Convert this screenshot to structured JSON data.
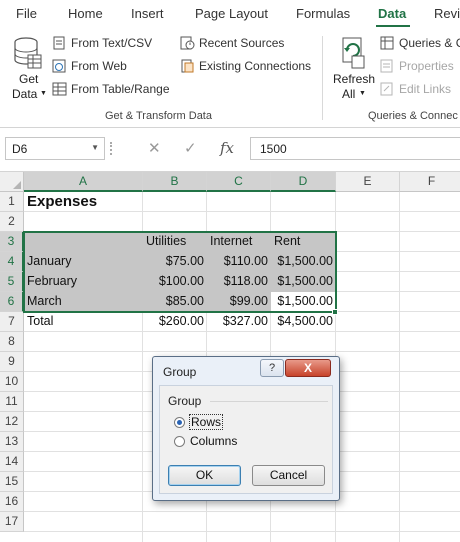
{
  "tabs": [
    {
      "label": "File"
    },
    {
      "label": "Home"
    },
    {
      "label": "Insert"
    },
    {
      "label": "Page Layout"
    },
    {
      "label": "Formulas"
    },
    {
      "label": "Data"
    },
    {
      "label": "Revie"
    }
  ],
  "active_tab": "Data",
  "ribbon": {
    "get_data_line1": "Get",
    "get_data_line2": "Data",
    "from_text_csv": "From Text/CSV",
    "from_web": "From Web",
    "from_table_range": "From Table/Range",
    "recent_sources": "Recent Sources",
    "existing_connections": "Existing Connections",
    "group_get_transform": "Get & Transform Data",
    "refresh_line1": "Refresh",
    "refresh_line2": "All",
    "queries_connections": "Queries & C",
    "properties": "Properties",
    "edit_links": "Edit Links",
    "group_queries": "Queries & Connec"
  },
  "formula_bar": {
    "name_box": "D6",
    "fx": "fx",
    "value": "1500"
  },
  "grid": {
    "columns": [
      "A",
      "B",
      "C",
      "D",
      "E",
      "F"
    ],
    "rows": [
      "1",
      "2",
      "3",
      "4",
      "5",
      "6",
      "7",
      "8",
      "9",
      "10",
      "11",
      "12",
      "13",
      "14",
      "15",
      "16",
      "17"
    ],
    "title": "Expenses",
    "headers": [
      "Utilities",
      "Internet",
      "Rent"
    ],
    "data_rows": [
      {
        "label": "January",
        "utilities": "$75.00",
        "internet": "$110.00",
        "rent": "$1,500.00"
      },
      {
        "label": "February",
        "utilities": "$100.00",
        "internet": "$118.00",
        "rent": "$1,500.00"
      },
      {
        "label": "March",
        "utilities": "$85.00",
        "internet": "$99.00",
        "rent": "$1,500.00"
      }
    ],
    "total": {
      "label": "Total",
      "utilities": "$260.00",
      "internet": "$327.00",
      "rent": "$4,500.00"
    }
  },
  "dialog": {
    "title": "Group",
    "help": "?",
    "close": "X",
    "group_label": "Group",
    "option_rows": "Rows",
    "option_columns": "Columns",
    "selected": "Rows",
    "ok": "OK",
    "cancel": "Cancel"
  },
  "colors": {
    "accent": "#217346",
    "selection_fill": "#c6c6c6"
  }
}
